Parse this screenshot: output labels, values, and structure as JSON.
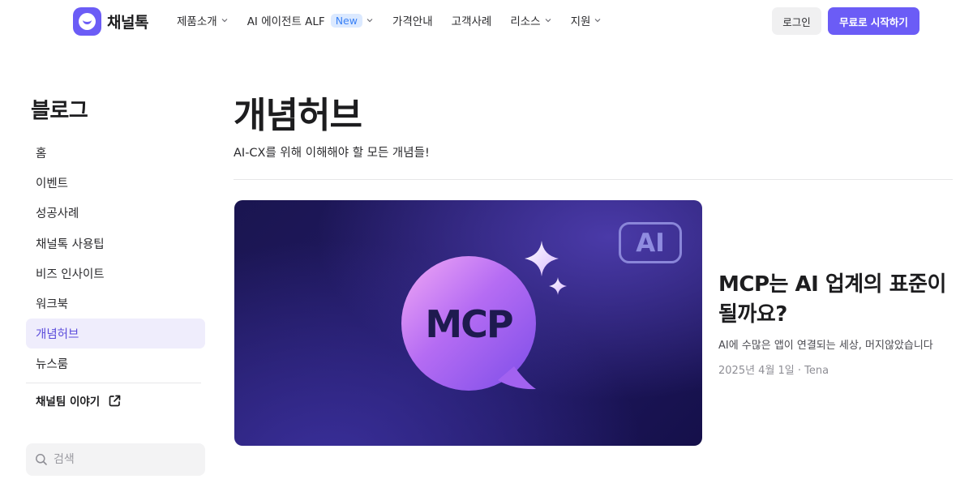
{
  "header": {
    "logo_text": "채널톡",
    "nav": [
      {
        "label": "제품소개",
        "has_dropdown": true
      },
      {
        "label": "AI 에이전트 ALF",
        "badge": "New",
        "has_dropdown": true
      },
      {
        "label": "가격안내",
        "has_dropdown": false
      },
      {
        "label": "고객사례",
        "has_dropdown": false
      },
      {
        "label": "리소스",
        "has_dropdown": true
      },
      {
        "label": "지원",
        "has_dropdown": true
      }
    ],
    "login_label": "로그인",
    "start_label": "무료로 시작하기"
  },
  "sidebar": {
    "title": "블로그",
    "items": [
      {
        "label": "홈",
        "active": false
      },
      {
        "label": "이벤트",
        "active": false
      },
      {
        "label": "성공사례",
        "active": false
      },
      {
        "label": "채널톡 사용팁",
        "active": false
      },
      {
        "label": "비즈 인사이트",
        "active": false
      },
      {
        "label": "워크북",
        "active": false
      },
      {
        "label": "개념허브",
        "active": true
      },
      {
        "label": "뉴스룸",
        "active": false
      }
    ],
    "external_link_label": "채널팀 이야기",
    "search_placeholder": "검색"
  },
  "main": {
    "title": "개념허브",
    "description": "AI-CX를 위해 이해해야 할 모든 개념들!",
    "featured_post": {
      "thumbnail_badge": "AI",
      "thumbnail_text": "MCP",
      "title": "MCP는 AI 업계의 표준이 될까요?",
      "summary": "AI에 수많은 앱이 연결되는 세상, 머지않았습니다",
      "meta": "2025년 4월 1일 · Tena"
    }
  },
  "colors": {
    "accent": "#6b5cf6",
    "active_bg": "#efedfc",
    "active_text": "#5b4cdb",
    "badge_bg": "#dbe9ff",
    "badge_text": "#3b82f6"
  },
  "icons": [
    "logo-mark",
    "chevron-down-icon",
    "external-link-icon",
    "search-icon",
    "sparkle-icon",
    "speech-bubble-icon"
  ]
}
